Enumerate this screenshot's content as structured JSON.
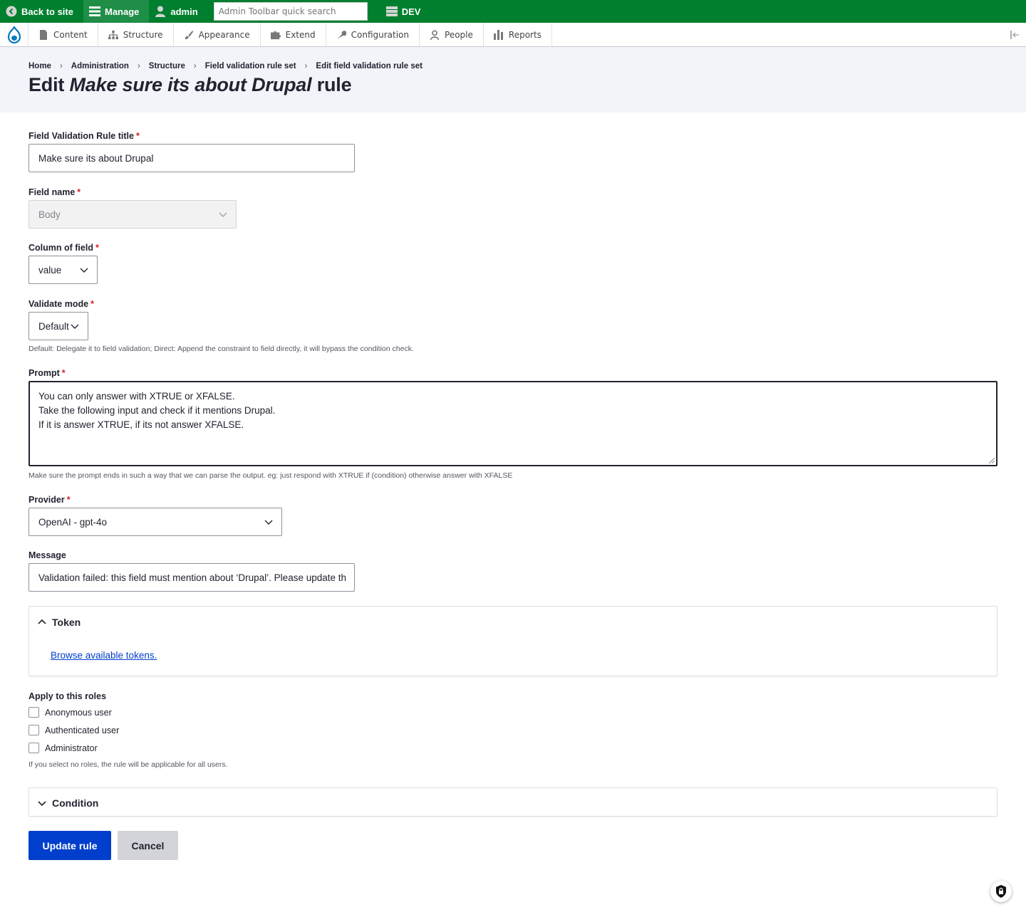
{
  "toolbar": {
    "back_label": "Back to site",
    "manage_label": "Manage",
    "user_label": "admin",
    "search_placeholder": "Admin Toolbar quick search",
    "env_label": "DEV"
  },
  "tray": {
    "items": [
      {
        "label": "Content",
        "icon": "file-icon"
      },
      {
        "label": "Structure",
        "icon": "sitemap-icon"
      },
      {
        "label": "Appearance",
        "icon": "paintbrush-icon"
      },
      {
        "label": "Extend",
        "icon": "puzzle-icon"
      },
      {
        "label": "Configuration",
        "icon": "wrench-icon"
      },
      {
        "label": "People",
        "icon": "people-icon"
      },
      {
        "label": "Reports",
        "icon": "bar-chart-icon"
      }
    ]
  },
  "breadcrumb": [
    "Home",
    "Administration",
    "Structure",
    "Field validation rule set",
    "Edit field validation rule set"
  ],
  "title": {
    "prefix": "Edit ",
    "emphasis": "Make sure its about Drupal",
    "suffix": " rule"
  },
  "form": {
    "rule_title": {
      "label": "Field Validation Rule title",
      "value": "Make sure its about Drupal"
    },
    "field_name": {
      "label": "Field name",
      "value": "Body"
    },
    "column": {
      "label": "Column of field",
      "value": "value"
    },
    "validate_mode": {
      "label": "Validate mode",
      "value": "Default",
      "description": "Default: Delegate it to field validation; Direct: Append the constraint to field directly, it will bypass the condition check."
    },
    "prompt": {
      "label": "Prompt",
      "lines": [
        "You can only answer with XTRUE or XFALSE.",
        "Take the following input and check if it mentions Drupal.",
        "If it is answer XTRUE, if its not answer XFALSE."
      ],
      "description": "Make sure the prompt ends in such a way that we can parse the output. eg: just respond with XTRUE if (condition) otherwise answer with XFALSE"
    },
    "provider": {
      "label": "Provider",
      "value": "OpenAI - gpt-4o"
    },
    "message": {
      "label": "Message",
      "value": "Validation failed: this field must mention about ‘Drupal’. Please update th"
    },
    "token": {
      "summary": "Token",
      "link": "Browse available tokens."
    },
    "roles": {
      "label": "Apply to this roles",
      "options": [
        "Anonymous user",
        "Authenticated user",
        "Administrator"
      ],
      "description": "If you select no roles, the rule will be applicable for all users."
    },
    "condition": {
      "summary": "Condition"
    },
    "buttons": {
      "submit": "Update rule",
      "cancel": "Cancel"
    }
  },
  "colors": {
    "toolbar": "#007f2e",
    "primary": "#003ecc",
    "required": "#d72222"
  }
}
